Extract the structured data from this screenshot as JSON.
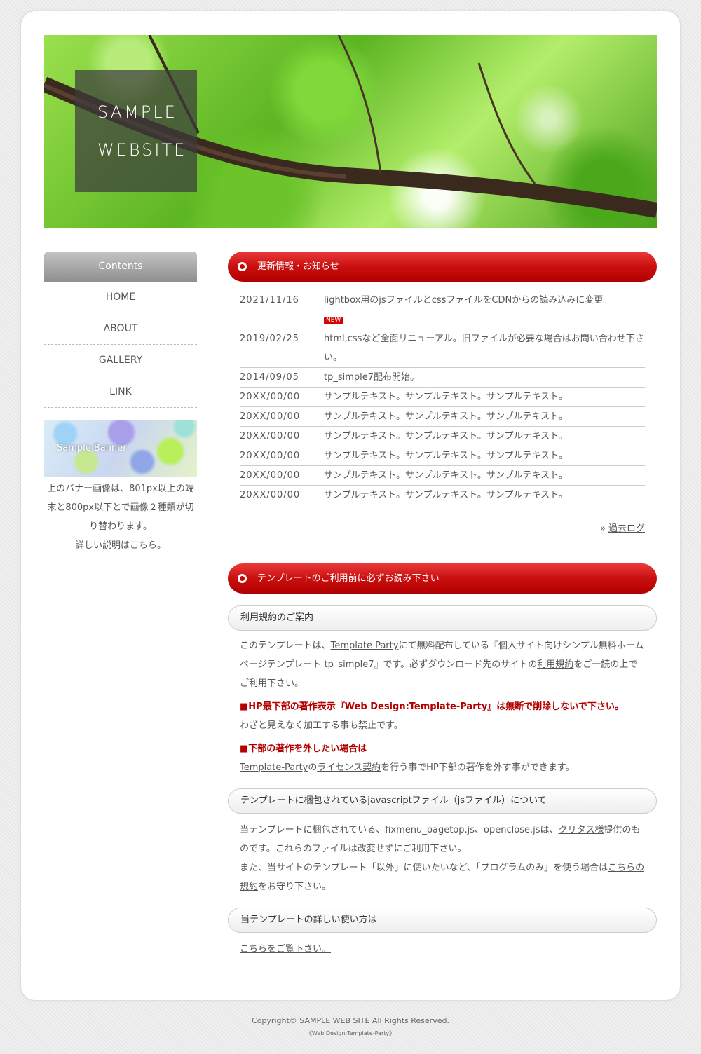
{
  "header": {
    "logo_line1": "SAMPLE",
    "logo_line2": "WEBSITE"
  },
  "sidebar": {
    "menu_title": "Contents",
    "items": [
      {
        "label": "HOME"
      },
      {
        "label": "ABOUT"
      },
      {
        "label": "GALLERY"
      },
      {
        "label": "LINK"
      }
    ],
    "banner_label": "Sample Banner",
    "note_line1": "上のバナー画像は、801px以上の端",
    "note_line2": "末と800px以下とで画像２種類が切",
    "note_line3": "り替わります。",
    "note_link": "詳しい説明はこちら。"
  },
  "news": {
    "title": "更新情報・お知らせ",
    "new_badge": "NEW",
    "items": [
      {
        "date": "2021/11/16",
        "text": "lightbox用のjsファイルとcssファイルをCDNからの読み込みに変更。"
      },
      {
        "date": "2019/02/25",
        "text": "html,cssなど全面リニューアル。旧ファイルが必要な場合はお問い合わせ下さい。"
      },
      {
        "date": "2014/09/05",
        "text": "tp_simple7配布開始。"
      },
      {
        "date": "20XX/00/00",
        "text": "サンプルテキスト。サンプルテキスト。サンプルテキスト。"
      },
      {
        "date": "20XX/00/00",
        "text": "サンプルテキスト。サンプルテキスト。サンプルテキスト。"
      },
      {
        "date": "20XX/00/00",
        "text": "サンプルテキスト。サンプルテキスト。サンプルテキスト。"
      },
      {
        "date": "20XX/00/00",
        "text": "サンプルテキスト。サンプルテキスト。サンプルテキスト。"
      },
      {
        "date": "20XX/00/00",
        "text": "サンプルテキスト。サンプルテキスト。サンプルテキスト。"
      },
      {
        "date": "20XX/00/00",
        "text": "サンプルテキスト。サンプルテキスト。サンプルテキスト。"
      }
    ],
    "more_prefix": "» ",
    "more_link": "過去ログ"
  },
  "template": {
    "title": "テンプレートのご利用前に必ずお読み下さい",
    "section1_title": "利用規約のご案内",
    "p1_a": "このテンプレートは、",
    "p1_link1": "Template Party",
    "p1_b": "にて無料配布している『個人サイト向けシンプル無料ホームページテンプレート tp_simple7』です。必ずダウンロード先のサイトの",
    "p1_link2": "利用規約",
    "p1_c": "をご一読の上でご利用下さい。",
    "warn1": "■HP最下部の著作表示『Web Design:Template-Party』は無断で削除しないで下さい。",
    "p2": "わざと見えなく加工する事も禁止です。",
    "warn2": "■下部の著作を外したい場合は",
    "p3_link1": "Template-Party",
    "p3_a": "の",
    "p3_link2": "ライセンス契約",
    "p3_b": "を行う事でHP下部の著作を外す事ができます。",
    "section2_title": "テンプレートに梱包されているjavascriptファイル（jsファイル）について",
    "p4_a": "当テンプレートに梱包されている、fixmenu_pagetop.js、openclose.jsは、",
    "p4_link": "クリタス様",
    "p4_b": "提供のものです。これらのファイルは改変せずにご利用下さい。",
    "p4_c": "また、当サイトのテンプレート「以外」に使いたいなど、「プログラムのみ」を使う場合は",
    "p4_link2": "こちらの規約",
    "p4_d": "をお守り下さい。",
    "section3_title": "当テンプレートの詳しい使い方は",
    "p5_link": "こちらをご覧下さい。"
  },
  "footer": {
    "copyright": "Copyright© SAMPLE WEB SITE All Rights Reserved.",
    "credit": "《Web Design:Template-Party》"
  }
}
